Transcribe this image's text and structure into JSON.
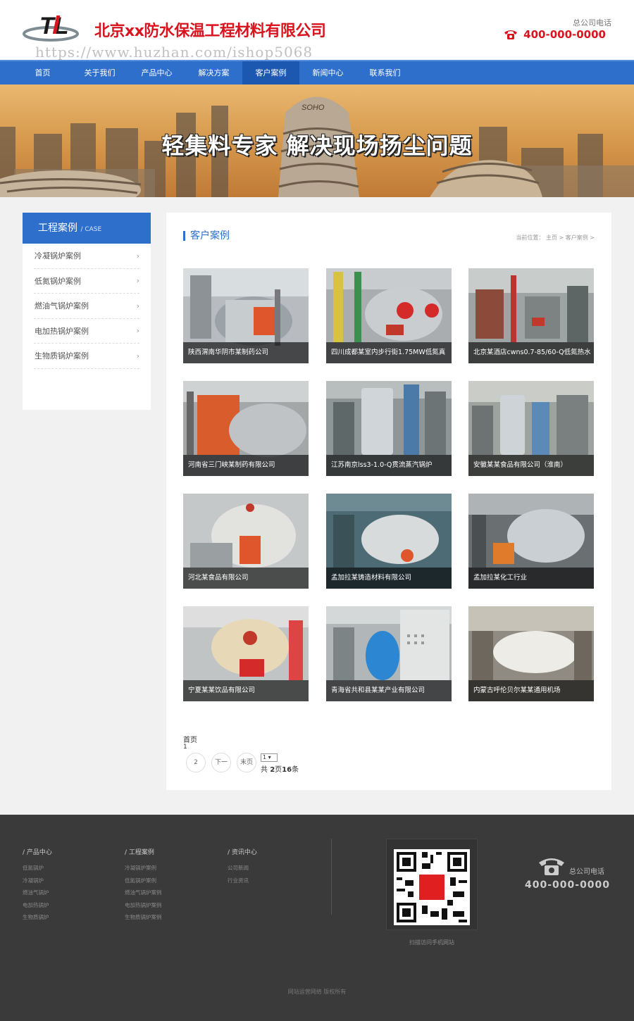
{
  "header": {
    "company_name": "北京xx防水保温工程材料有限公司",
    "logo_text": "TL",
    "watermark": "https://www.huzhan.com/ishop5068",
    "hotline_label": "总公司电话",
    "hotline_number": "400-000-0000"
  },
  "nav": {
    "items": [
      {
        "label": "首页"
      },
      {
        "label": "关于我们"
      },
      {
        "label": "产品中心"
      },
      {
        "label": "解决方案"
      },
      {
        "label": "客户案例",
        "active": true
      },
      {
        "label": "新闻中心"
      },
      {
        "label": "联系我们"
      }
    ]
  },
  "banner": {
    "slogan": "轻集料专家 解决现场扬尘问题",
    "building_sign": "SOHO"
  },
  "sidebar": {
    "title": "工程案例",
    "title_en": "/ CASE",
    "items": [
      {
        "label": "冷凝锅炉案例"
      },
      {
        "label": "低氮锅炉案例"
      },
      {
        "label": "燃油气锅炉案例"
      },
      {
        "label": "电加热锅炉案例"
      },
      {
        "label": "生物质锅炉案例"
      }
    ]
  },
  "main": {
    "title": "客户案例",
    "breadcrumb": "当前位置： 主页 > 客户案例 >",
    "cases": [
      {
        "caption": "陕西渭南华阴市某制药公司"
      },
      {
        "caption": "四川成都某室内步行街1.75MW低氮真"
      },
      {
        "caption": "北京某酒店cwns0.7-85/60-Q低氮热水"
      },
      {
        "caption": "河南省三门峡某制药有限公司"
      },
      {
        "caption": "江苏南京lss3-1.0-Q贯流蒸汽锅炉"
      },
      {
        "caption": "安徽某某食品有限公司（淮南）"
      },
      {
        "caption": "河北某食品有限公司"
      },
      {
        "caption": "孟加拉某铸造材料有限公司"
      },
      {
        "caption": "孟加拉某化工行业"
      },
      {
        "caption": "宁夏某某饮品有限公司"
      },
      {
        "caption": "青海省共和县某某产业有限公司"
      },
      {
        "caption": "内蒙古呼伦贝尔某某通用机场"
      }
    ],
    "pager": {
      "first": "首页",
      "current": "1",
      "page2": "2",
      "next": "下一",
      "last": "末页",
      "select_value": "1",
      "total_prefix": "共",
      "total_pages": "2",
      "total_pages_unit": "页",
      "total_items": "16",
      "total_items_unit": "条"
    }
  },
  "footer": {
    "columns": [
      {
        "title": "/ 产品中心",
        "items": [
          "低氮锅炉",
          "冷凝锅炉",
          "燃油气锅炉",
          "电加热锅炉",
          "生物质锅炉"
        ]
      },
      {
        "title": "/ 工程案例",
        "items": [
          "冷凝锅炉案例",
          "低氮锅炉案例",
          "燃油气锅炉案例",
          "电加热锅炉案例",
          "生物质锅炉案例"
        ]
      },
      {
        "title": "/ 资讯中心",
        "items": [
          "公司新闻",
          "行业资讯"
        ]
      }
    ],
    "qr_label": "扫描访问手机网站",
    "phone_label": "总公司电话",
    "phone": "400-000-0000",
    "copyright": "网站运营网络 版权所有"
  },
  "colors": {
    "brand_blue": "#2f6fcc",
    "brand_red": "#d8141e",
    "footer_bg": "#3a3a3a"
  }
}
